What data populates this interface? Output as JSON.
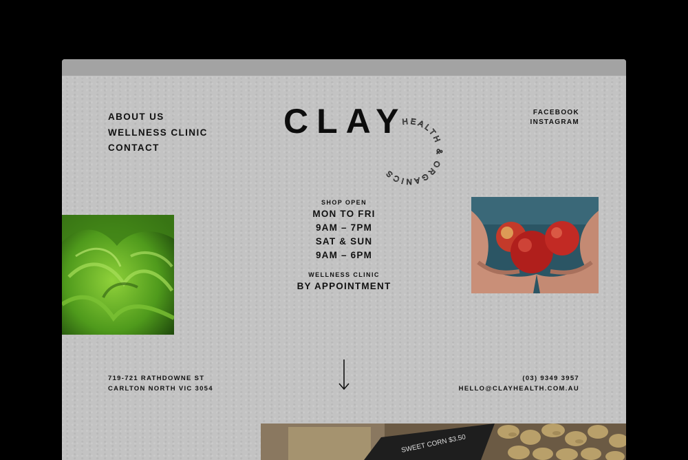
{
  "nav": {
    "items": [
      {
        "label": "ABOUT US"
      },
      {
        "label": "WELLNESS CLINIC"
      },
      {
        "label": "CONTACT"
      }
    ]
  },
  "logo": {
    "word": "CLAY",
    "seal_text": "HEALTH & ORGANICS"
  },
  "social": {
    "facebook": "FACEBOOK",
    "instagram": "INSTAGRAM"
  },
  "hours": {
    "shop_label": "SHOP OPEN",
    "weekday_days": "MON TO FRI",
    "weekday_time": "9AM – 7PM",
    "weekend_days": "SAT & SUN",
    "weekend_time": "9AM – 6PM",
    "clinic_label": "WELLNESS CLINIC",
    "clinic_value": "BY APPOINTMENT"
  },
  "address": {
    "line1": "719-721 RATHDOWNE ST",
    "line2": "CARLTON NORTH VIC 3054"
  },
  "contact": {
    "phone": "(03) 9349 3957",
    "email": "HELLO@CLAYHEALTH.COM.AU"
  },
  "sign_text": "SWEET CORN $3.50",
  "icons": {
    "scroll": "down-arrow-icon"
  },
  "colors": {
    "paper": "#c3c3c3",
    "text": "#111111",
    "frame": "#000000"
  }
}
